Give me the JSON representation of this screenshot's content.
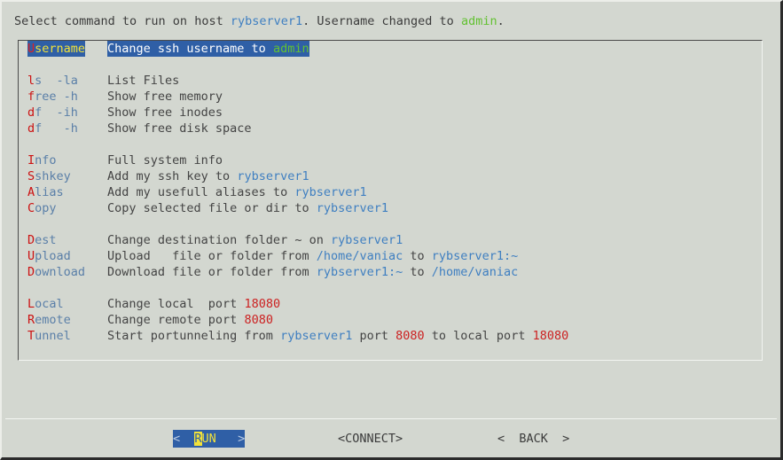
{
  "header": {
    "prefix": "Select command to run on host ",
    "host": "rybserver1",
    "middle": ". Username changed to ",
    "user": "admin",
    "suffix": "."
  },
  "menu": {
    "groups": [
      {
        "rows": [
          {
            "selected": true,
            "cmd_hotkey": "U",
            "cmd_rest": "sername",
            "desc_parts": [
              {
                "text": "Change ssh username to ",
                "style": "txt"
              },
              {
                "text": "admin",
                "style": "ok"
              }
            ]
          }
        ]
      },
      {
        "rows": [
          {
            "selected": false,
            "cmd_hotkey": "l",
            "cmd_rest": "s  -la",
            "desc_parts": [
              {
                "text": "List Files",
                "style": "txt"
              }
            ]
          },
          {
            "selected": false,
            "cmd_hotkey": "f",
            "cmd_rest": "ree -h",
            "desc_parts": [
              {
                "text": "Show free memory",
                "style": "txt"
              }
            ]
          },
          {
            "selected": false,
            "cmd_hotkey": "d",
            "cmd_rest": "f  -ih",
            "desc_parts": [
              {
                "text": "Show free inodes",
                "style": "txt"
              }
            ]
          },
          {
            "selected": false,
            "cmd_hotkey": "d",
            "cmd_rest": "f   -h",
            "desc_parts": [
              {
                "text": "Show free disk space",
                "style": "txt"
              }
            ]
          }
        ]
      },
      {
        "rows": [
          {
            "selected": false,
            "cmd_hotkey": "I",
            "cmd_rest": "nfo",
            "desc_parts": [
              {
                "text": "Full system info",
                "style": "txt"
              }
            ]
          },
          {
            "selected": false,
            "cmd_hotkey": "S",
            "cmd_rest": "shkey",
            "desc_parts": [
              {
                "text": "Add my ssh key to ",
                "style": "txt"
              },
              {
                "text": "rybserver1",
                "style": "host"
              }
            ]
          },
          {
            "selected": false,
            "cmd_hotkey": "A",
            "cmd_rest": "lias",
            "desc_parts": [
              {
                "text": "Add my usefull aliases to ",
                "style": "txt"
              },
              {
                "text": "rybserver1",
                "style": "host"
              }
            ]
          },
          {
            "selected": false,
            "cmd_hotkey": "C",
            "cmd_rest": "opy",
            "desc_parts": [
              {
                "text": "Copy selected file or dir to ",
                "style": "txt"
              },
              {
                "text": "rybserver1",
                "style": "host"
              }
            ]
          }
        ]
      },
      {
        "rows": [
          {
            "selected": false,
            "cmd_hotkey": "D",
            "cmd_rest": "est",
            "desc_parts": [
              {
                "text": "Change destination folder ~ on ",
                "style": "txt"
              },
              {
                "text": "rybserver1",
                "style": "host"
              }
            ]
          },
          {
            "selected": false,
            "cmd_hotkey": "U",
            "cmd_rest": "pload",
            "desc_parts": [
              {
                "text": "Upload   file or folder from ",
                "style": "txt"
              },
              {
                "text": "/home/vaniac",
                "style": "host"
              },
              {
                "text": " to ",
                "style": "txt"
              },
              {
                "text": "rybserver1:~",
                "style": "host"
              }
            ]
          },
          {
            "selected": false,
            "cmd_hotkey": "D",
            "cmd_rest": "ownload",
            "desc_parts": [
              {
                "text": "Download file or folder from ",
                "style": "txt"
              },
              {
                "text": "rybserver1:~",
                "style": "host"
              },
              {
                "text": " to ",
                "style": "txt"
              },
              {
                "text": "/home/vaniac",
                "style": "host"
              }
            ]
          }
        ]
      },
      {
        "rows": [
          {
            "selected": false,
            "cmd_hotkey": "L",
            "cmd_rest": "ocal",
            "desc_parts": [
              {
                "text": "Change local  port ",
                "style": "txt"
              },
              {
                "text": "18080",
                "style": "num"
              }
            ]
          },
          {
            "selected": false,
            "cmd_hotkey": "R",
            "cmd_rest": "emote",
            "desc_parts": [
              {
                "text": "Change remote port ",
                "style": "txt"
              },
              {
                "text": "8080",
                "style": "num"
              }
            ]
          },
          {
            "selected": false,
            "cmd_hotkey": "T",
            "cmd_rest": "unnel",
            "desc_parts": [
              {
                "text": "Start portunneling from ",
                "style": "txt"
              },
              {
                "text": "rybserver1",
                "style": "host"
              },
              {
                "text": " port ",
                "style": "txt"
              },
              {
                "text": "8080",
                "style": "num"
              },
              {
                "text": " to local port ",
                "style": "txt"
              },
              {
                "text": "18080",
                "style": "num"
              }
            ]
          }
        ]
      }
    ]
  },
  "buttons": {
    "run": {
      "left_arrow": "<  ",
      "hotkey": "R",
      "rest": "UN",
      "right_arrow": "   >"
    },
    "connect": {
      "label": "<CONNECT>"
    },
    "back": {
      "label": "<  BACK  >"
    }
  },
  "colors": {
    "background": "#d3d7d0",
    "hotkey_red": "#cc1111",
    "command_blue": "#5a7fa8",
    "host_blue": "#3f7fc1",
    "value_green": "#63c132",
    "number_red": "#cc2222",
    "highlight_blue": "#2f5fa6",
    "highlight_yellow": "#f2e23a",
    "text_gray": "#444444"
  }
}
